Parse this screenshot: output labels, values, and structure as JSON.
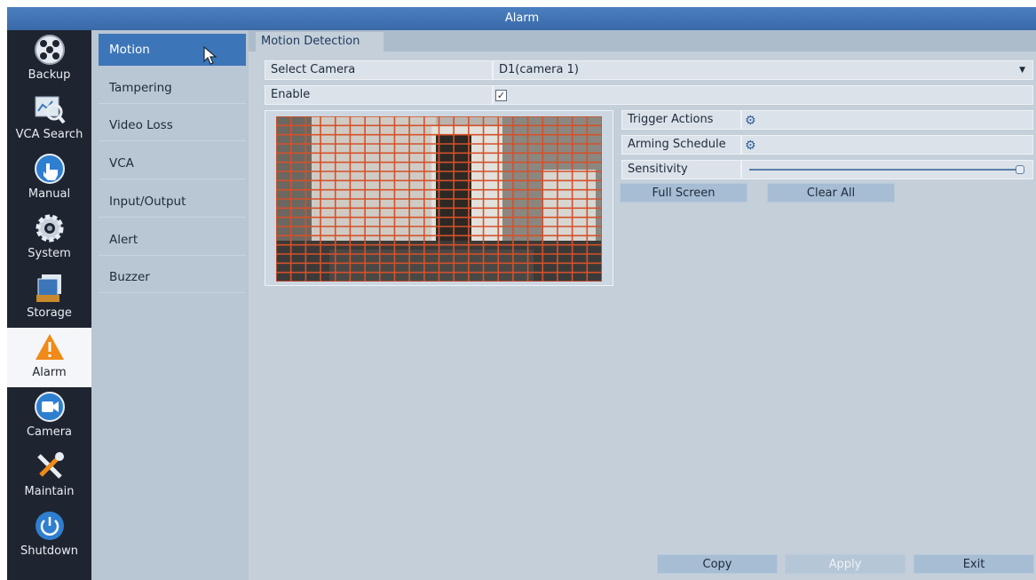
{
  "window": {
    "title": "Alarm"
  },
  "nav": [
    {
      "label": "Backup",
      "icon": "backup-icon",
      "active": false
    },
    {
      "label": "VCA Search",
      "icon": "vca-search-icon",
      "active": false
    },
    {
      "label": "Manual",
      "icon": "manual-icon",
      "active": false
    },
    {
      "label": "System",
      "icon": "system-icon",
      "active": false
    },
    {
      "label": "Storage",
      "icon": "storage-icon",
      "active": false
    },
    {
      "label": "Alarm",
      "icon": "alarm-icon",
      "active": true
    },
    {
      "label": "Camera",
      "icon": "camera-icon",
      "active": false
    },
    {
      "label": "Maintain",
      "icon": "maintain-icon",
      "active": false
    },
    {
      "label": "Shutdown",
      "icon": "shutdown-icon",
      "active": false
    }
  ],
  "submenu": [
    {
      "label": "Motion",
      "active": true
    },
    {
      "label": "Tampering"
    },
    {
      "label": "Video Loss"
    },
    {
      "label": "VCA"
    },
    {
      "label": "Input/Output"
    },
    {
      "label": "Alert"
    },
    {
      "label": "Buzzer"
    }
  ],
  "tab": {
    "label": "Motion Detection"
  },
  "form": {
    "select_camera_label": "Select Camera",
    "select_camera_value": "D1(camera 1)",
    "enable_label": "Enable",
    "enable_checked": true
  },
  "side": {
    "trigger_actions": "Trigger Actions",
    "arming_schedule": "Arming Schedule",
    "sensitivity_label": "Sensitivity",
    "sensitivity_value": 1.0,
    "full_screen": "Full Screen",
    "clear_all": "Clear All"
  },
  "footer": {
    "copy": "Copy",
    "apply": "Apply",
    "exit": "Exit"
  },
  "colors": {
    "grid": "#d4512a",
    "accent": "#3d76b8"
  }
}
